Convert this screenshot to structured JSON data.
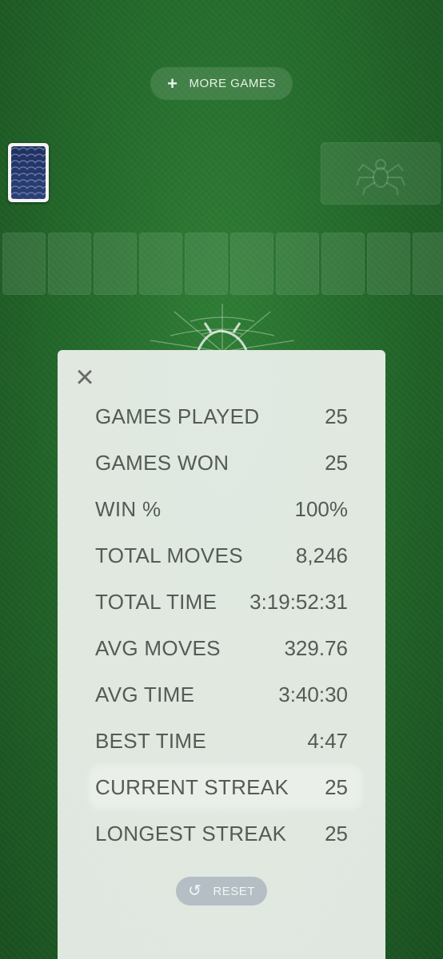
{
  "header": {
    "more_games_label": "MORE GAMES",
    "plus_icon": "+"
  },
  "stats": {
    "close_icon": "×",
    "rows": [
      {
        "label": "GAMES PLAYED",
        "value": "25"
      },
      {
        "label": "GAMES WON",
        "value": "25"
      },
      {
        "label": "WIN %",
        "value": "100%"
      },
      {
        "label": "TOTAL MOVES",
        "value": "8,246"
      },
      {
        "label": "TOTAL TIME",
        "value": "3:19:52:31"
      },
      {
        "label": "AVG MOVES",
        "value": "329.76"
      },
      {
        "label": "AVG TIME",
        "value": "3:40:30"
      },
      {
        "label": "BEST TIME",
        "value": "4:47"
      },
      {
        "label": "CURRENT STREAK",
        "value": "25"
      },
      {
        "label": "LONGEST STREAK",
        "value": "25"
      }
    ],
    "reset_label": "RESET",
    "reset_icon": "↺"
  },
  "colors": {
    "felt": "#246a2b",
    "panel": "#ecf0ec",
    "card_back": "#21315e",
    "reset_button": "#b4bec4"
  },
  "icons": [
    "plus-icon",
    "spider-icon",
    "spider-web-icon",
    "close-icon",
    "reset-icon"
  ]
}
